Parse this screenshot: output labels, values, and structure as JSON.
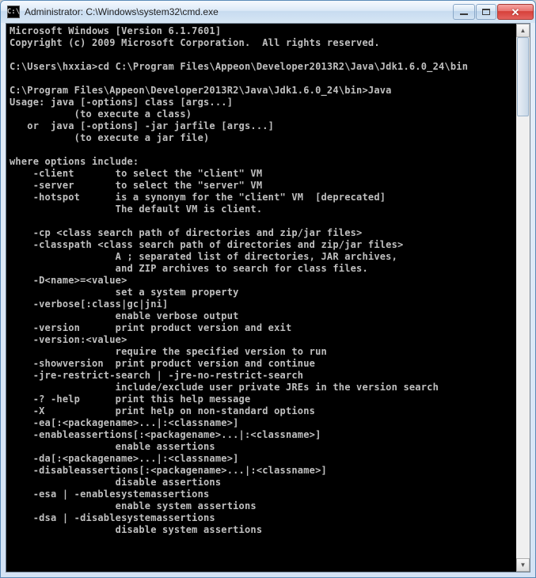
{
  "window": {
    "title": "Administrator: C:\\Windows\\system32\\cmd.exe",
    "icon_label": "C:\\"
  },
  "console": {
    "lines": [
      "Microsoft Windows [Version 6.1.7601]",
      "Copyright (c) 2009 Microsoft Corporation.  All rights reserved.",
      "",
      "C:\\Users\\hxxia>cd C:\\Program Files\\Appeon\\Developer2013R2\\Java\\Jdk1.6.0_24\\bin",
      "",
      "C:\\Program Files\\Appeon\\Developer2013R2\\Java\\Jdk1.6.0_24\\bin>Java",
      "Usage: java [-options] class [args...]",
      "           (to execute a class)",
      "   or  java [-options] -jar jarfile [args...]",
      "           (to execute a jar file)",
      "",
      "where options include:",
      "    -client       to select the \"client\" VM",
      "    -server       to select the \"server\" VM",
      "    -hotspot      is a synonym for the \"client\" VM  [deprecated]",
      "                  The default VM is client.",
      "",
      "    -cp <class search path of directories and zip/jar files>",
      "    -classpath <class search path of directories and zip/jar files>",
      "                  A ; separated list of directories, JAR archives,",
      "                  and ZIP archives to search for class files.",
      "    -D<name>=<value>",
      "                  set a system property",
      "    -verbose[:class|gc|jni]",
      "                  enable verbose output",
      "    -version      print product version and exit",
      "    -version:<value>",
      "                  require the specified version to run",
      "    -showversion  print product version and continue",
      "    -jre-restrict-search | -jre-no-restrict-search",
      "                  include/exclude user private JREs in the version search",
      "    -? -help      print this help message",
      "    -X            print help on non-standard options",
      "    -ea[:<packagename>...|:<classname>]",
      "    -enableassertions[:<packagename>...|:<classname>]",
      "                  enable assertions",
      "    -da[:<packagename>...|:<classname>]",
      "    -disableassertions[:<packagename>...|:<classname>]",
      "                  disable assertions",
      "    -esa | -enablesystemassertions",
      "                  enable system assertions",
      "    -dsa | -disablesystemassertions",
      "                  disable system assertions"
    ]
  }
}
